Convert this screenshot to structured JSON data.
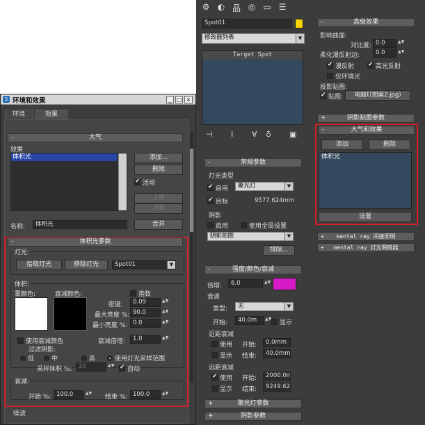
{
  "env_window": {
    "title": "环境和效果",
    "tabs": [
      "环境",
      "效果"
    ],
    "atmosphere": {
      "header": "大气",
      "effects_label": "效果",
      "list_items": [
        "体积光"
      ],
      "add": "添加...",
      "delete": "删除",
      "active": "活动",
      "move_up": "上移",
      "move_down": "下移",
      "name_label": "名称:",
      "name_value": "体积光",
      "merge": "合并"
    },
    "vol": {
      "header": "体积光参数",
      "light_group": "灯光:",
      "pick_light": "拾取灯光",
      "remove_light": "移除灯光",
      "light_value": "Spot01",
      "volume_group": "体积:",
      "fog_color": "雾颜色:",
      "atten_color": "衰减颜色:",
      "exponential": "指数",
      "density_label": "密度:",
      "density": "0.09",
      "max_bright_label": "最大亮度 %:",
      "max_bright": "90.0",
      "min_bright_label": "最小亮度 %:",
      "min_bright": "0.0",
      "use_atten": "使用衰减颜色",
      "atten_mult_label": "衰减倍增:",
      "atten_mult": "1.0",
      "filter_shadow": "过滤阴影:",
      "low": "低",
      "mid": "中",
      "high": "高",
      "use_sample": "使用灯光采样范围",
      "sample_vol_label": "采样体积 %:",
      "sample_vol": "20",
      "auto": "自动",
      "atten_group": "衰减:",
      "start_label": "开始 %:",
      "start": "100.0",
      "end_label": "结束 %:",
      "end": "100.0",
      "noise": "噪波"
    }
  },
  "modifier": {
    "name_value": "Spot01",
    "color": "#f5d400",
    "mod_list": "修改器列表",
    "stack_item": "Target Spot",
    "general": {
      "header": "常规参数",
      "light_type": "灯光类型",
      "on": "启用",
      "type_value": "聚光灯",
      "target": "目标",
      "target_dist": "9577.624mm",
      "shadows": "阴影",
      "shadow_on": "启用",
      "use_global": "使用全局设置",
      "shadow_type": "阴影贴图",
      "exclude": "排除..."
    },
    "intensity": {
      "header": "强度/颜色/衰减",
      "mult_label": "倍增:",
      "mult": "6.0",
      "mult_color": "#d81bc8",
      "decay": "衰退",
      "type_label": "类型:",
      "type_value": "无",
      "start_label": "开始:",
      "start": "40.0m",
      "show": "显示",
      "near": "近距衰减",
      "use": "使用",
      "near_start_label": "开始:",
      "near_start": "0.0mm",
      "near_end_label": "结束:",
      "near_end": "40.0mm",
      "far": "远距衰减",
      "far_start": "2000.0m",
      "far_end": "9249.62"
    },
    "spot_params": "聚光灯参数",
    "shadow_params": "阴影参数",
    "advanced": {
      "header": "高级效果",
      "affect": "影响曲面:",
      "contrast_label": "对比度:",
      "contrast": "0.0",
      "soften_label": "柔化漫反射边:",
      "soften": "0.0",
      "diffuse": "漫反射",
      "specular": "高光反射",
      "ambient_only": "仅环境光",
      "proj_map": "投影贴图:",
      "map_label": "贴图:",
      "map_value": "电脑灯图案2.jpg)"
    },
    "shadow_map_params": "阴影贴图参数",
    "atm_effects": {
      "header": "大气和效果",
      "add": "添加",
      "delete": "删除",
      "item": "体积光",
      "setup": "设置"
    },
    "mr_indirect": "mental ray 间接照明",
    "mr_shader": "mental ray 灯光明暗器"
  }
}
